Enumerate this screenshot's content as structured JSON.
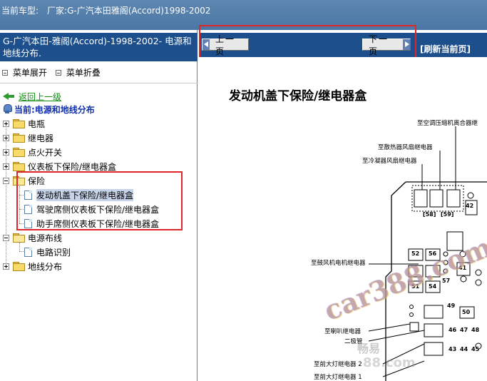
{
  "topbar": {
    "car_label": "当前车型:",
    "car_value": "厂家:G-广汽本田雅阁(Accord)1998-2002"
  },
  "left": {
    "title": "G-广汽本田-雅阁(Accord)-1998-2002- 电源和地线分布.",
    "expand_menu": "菜单展开",
    "collapse_menu": "菜单折叠",
    "back_link": "返回上一级",
    "current": "当前:电源和地线分布",
    "tree": [
      {
        "label": "电瓶"
      },
      {
        "label": "继电器"
      },
      {
        "label": "点火开关"
      },
      {
        "label": "仪表板下保险/继电器盒"
      },
      {
        "label": "保险",
        "children": [
          {
            "label": "发动机盖下保险/继电器盒"
          },
          {
            "label": "驾驶席侧仪表板下保险/继电器盒"
          },
          {
            "label": "助手席侧仪表板下保险/继电器盒"
          }
        ]
      },
      {
        "label": "电源布线",
        "children": [
          {
            "label": "电路识别"
          }
        ]
      },
      {
        "label": "地线分布"
      }
    ]
  },
  "nav": {
    "prev": "上一页",
    "next": "下一页",
    "refresh": "[刷新当前页]"
  },
  "diagram": {
    "title": "发动机盖下保险/继电器盒",
    "labels": {
      "ac_relay": "至空调压缩机离合器继",
      "radiator_relay": "至散热器风扇继电器",
      "condenser_relay": "至冷凝器风扇继电器",
      "blower_relay": "至鼓风机电机继电器",
      "horn_relay": "至喇叭继电器",
      "diode": "二极管",
      "headlight2": "至前大灯继电器 2",
      "headlight1": "至前大灯继电器 1"
    },
    "fuses": {
      "f42": "42",
      "f58": "[58]",
      "f59": "[59]",
      "f52": "52",
      "f56": "56",
      "f41": "41",
      "f51": "51",
      "f54": "54",
      "f57": "57",
      "f49": "49",
      "f50": "50",
      "f46": "46",
      "f47": "47",
      "f48": "48",
      "f43": "43",
      "f44": "44",
      "f45": "45"
    },
    "watermarks": {
      "main": "car388.com",
      "cn": "畅易",
      "sub": "88.com"
    }
  },
  "colors": {
    "topbar": "#4a77a5",
    "header": "#1c4f8c",
    "highlight_box": "#e0262b",
    "back_link": "#128a12",
    "current": "#1030b0"
  }
}
